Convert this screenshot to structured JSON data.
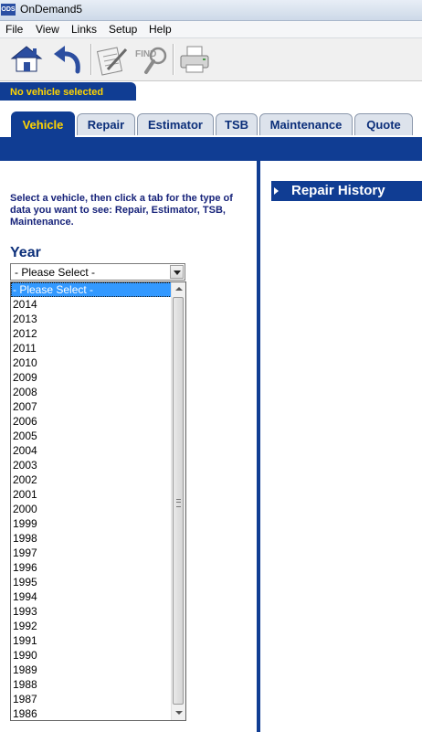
{
  "window": {
    "app_logo": "ODS",
    "title": "OnDemand5"
  },
  "menu": [
    "File",
    "View",
    "Links",
    "Setup",
    "Help"
  ],
  "toolbar": {
    "find_label": "FIND"
  },
  "status": {
    "vehicle_status": "No vehicle selected"
  },
  "tabs": [
    {
      "label": "Vehicle",
      "active": true
    },
    {
      "label": "Repair",
      "active": false
    },
    {
      "label": "Estimator",
      "active": false
    },
    {
      "label": "TSB",
      "active": false
    },
    {
      "label": "Maintenance",
      "active": false
    },
    {
      "label": "Quote",
      "active": false
    }
  ],
  "vehicle_panel": {
    "instructions": "Select a vehicle, then click a tab for the type of data you want to see: Repair, Estimator, TSB, Maintenance.",
    "year_label": "Year",
    "year_select": {
      "selected": "- Please Select -",
      "options": [
        "- Please Select -",
        "2014",
        "2013",
        "2012",
        "2011",
        "2010",
        "2009",
        "2008",
        "2007",
        "2006",
        "2005",
        "2004",
        "2003",
        "2002",
        "2001",
        "2000",
        "1999",
        "1998",
        "1997",
        "1996",
        "1995",
        "1994",
        "1993",
        "1992",
        "1991",
        "1990",
        "1989",
        "1988",
        "1987",
        "1986"
      ]
    }
  },
  "right_panel": {
    "repair_history_label": "Repair History"
  },
  "colors": {
    "brand_blue": "#103d93",
    "tab_active_text": "#ffd400",
    "selection": "#3399ff"
  }
}
